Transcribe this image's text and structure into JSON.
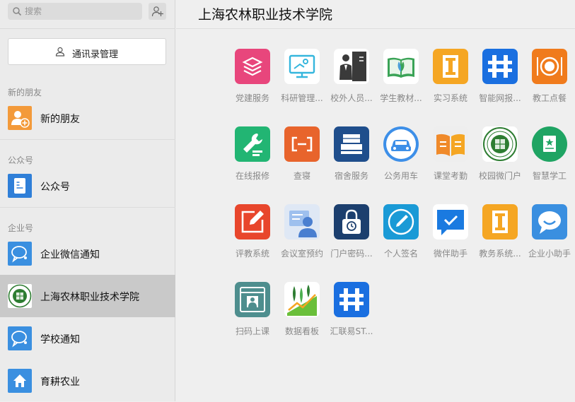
{
  "search": {
    "placeholder": "搜索"
  },
  "sidebar": {
    "contacts_button": "通讯录管理",
    "sections": [
      {
        "header": "新的朋友",
        "items": [
          {
            "label": "新的朋友",
            "icon": "new-friend-icon"
          }
        ]
      },
      {
        "header": "公众号",
        "items": [
          {
            "label": "公众号",
            "icon": "official-account-icon"
          }
        ]
      },
      {
        "header": "企业号",
        "items": [
          {
            "label": "企业微信通知",
            "icon": "chat-bubble-icon"
          },
          {
            "label": "上海农林职业技术学院",
            "icon": "college-seal-icon",
            "selected": true
          },
          {
            "label": "学校通知",
            "icon": "chat-bubble-icon"
          },
          {
            "label": "育耕农业",
            "icon": "home-icon"
          }
        ]
      }
    ]
  },
  "main": {
    "title": "上海农林职业技术学院",
    "apps": [
      {
        "label": "党建服务",
        "icon": "layers-icon",
        "color": "#e8467c"
      },
      {
        "label": "科研管理...",
        "icon": "monitor-icon",
        "color": "#35b6dd"
      },
      {
        "label": "校外人员...",
        "icon": "person-door-icon",
        "color": "#3a3a3a"
      },
      {
        "label": "学生教材...",
        "icon": "book-icon",
        "color": "#3aa356"
      },
      {
        "label": "实习系统",
        "icon": "letter-i-icon",
        "color": "#f5a623"
      },
      {
        "label": "智能网报...",
        "icon": "logo-h-icon",
        "color": "#1a6fe0"
      },
      {
        "label": "教工点餐",
        "icon": "plate-icon",
        "color": "#f07b1c"
      },
      {
        "label": "在线报修",
        "icon": "wrench-icon",
        "color": "#22b573"
      },
      {
        "label": "查寝",
        "icon": "bracket-icon",
        "color": "#e8642c"
      },
      {
        "label": "宿舍服务",
        "icon": "bed-icon",
        "color": "#1f4e8c"
      },
      {
        "label": "公务用车",
        "icon": "car-icon",
        "color": "#3d8fe8"
      },
      {
        "label": "课堂考勤",
        "icon": "open-book-icon",
        "color": "#f08a2a"
      },
      {
        "label": "校园微门户",
        "icon": "college-seal-icon",
        "color": "#2e7d32"
      },
      {
        "label": "智慧学工",
        "icon": "document-star-icon",
        "color": "#1fa463"
      },
      {
        "label": "评教系统",
        "icon": "edit-icon",
        "color": "#e8462c"
      },
      {
        "label": "会议室预约",
        "icon": "meeting-person-icon",
        "color": "#6a9ee8"
      },
      {
        "label": "门户密码...",
        "icon": "lock-icon",
        "color": "#1c3f6e"
      },
      {
        "label": "个人签名",
        "icon": "compass-pen-icon",
        "color": "#1a9ad6"
      },
      {
        "label": "微伴助手",
        "icon": "check-bubble-icon",
        "color": "#1a7ae0"
      },
      {
        "label": "教务系统...",
        "icon": "letter-i-icon",
        "color": "#f5a623"
      },
      {
        "label": "企业小助手",
        "icon": "chat-bubble-icon",
        "color": "#3a8fe0"
      },
      {
        "label": "扫码上课",
        "icon": "scan-person-icon",
        "color": "#4e8e8e"
      },
      {
        "label": "数据看板",
        "icon": "wheat-chart-icon",
        "color": "#6abf3a"
      },
      {
        "label": "汇联易ST...",
        "icon": "logo-h-icon",
        "color": "#1a6fe0"
      }
    ]
  }
}
